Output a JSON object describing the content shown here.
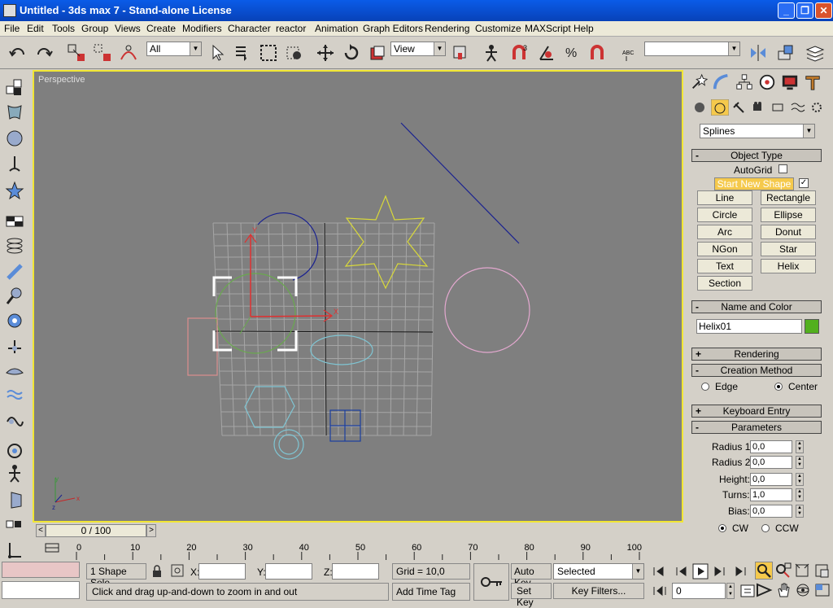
{
  "window": {
    "title": "Untitled - 3ds max 7  - Stand-alone License"
  },
  "menu": [
    "File",
    "Edit",
    "Tools",
    "Group",
    "Views",
    "Create",
    "Modifiers",
    "Character",
    "reactor",
    "Animation",
    "Graph Editors",
    "Rendering",
    "Customize",
    "MAXScript",
    "Help"
  ],
  "toolbar": {
    "selection_filter": "All",
    "ref_coord": "View",
    "named_selection": ""
  },
  "viewport": {
    "label": "Perspective"
  },
  "command_panel": {
    "category_dropdown": "Splines",
    "object_type": {
      "header": "Object Type",
      "autogrid": "AutoGrid",
      "start_new_shape": "Start New Shape",
      "buttons": [
        "Line",
        "Rectangle",
        "Circle",
        "Ellipse",
        "Arc",
        "Donut",
        "NGon",
        "Star",
        "Text",
        "Helix",
        "Section"
      ]
    },
    "name_color": {
      "header": "Name and Color",
      "name": "Helix01",
      "color": "#52b01e"
    },
    "rendering": {
      "header": "Rendering"
    },
    "creation_method": {
      "header": "Creation Method",
      "edge": "Edge",
      "center": "Center"
    },
    "keyboard_entry": {
      "header": "Keyboard Entry"
    },
    "parameters": {
      "header": "Parameters",
      "radius1_label": "Radius 1:",
      "radius1": "0,0",
      "radius2_label": "Radius 2:",
      "radius2": "0,0",
      "height_label": "Height:",
      "height": "0,0",
      "turns_label": "Turns:",
      "turns": "1,0",
      "bias_label": "Bias:",
      "bias": "0,0",
      "cw": "CW",
      "ccw": "CCW"
    }
  },
  "timeline": {
    "slider_label": "0 / 100",
    "ticks": [
      "0",
      "10",
      "20",
      "30",
      "40",
      "50",
      "60",
      "70",
      "80",
      "90",
      "100"
    ]
  },
  "status": {
    "selection": "1 Shape Sele",
    "x_label": "X:",
    "y_label": "Y:",
    "z_label": "Z:",
    "grid": "Grid = 10,0",
    "auto_key": "Auto Key",
    "set_key": "Set Key",
    "key_mode": "Selected",
    "key_filters": "Key Filters...",
    "add_time_tag": "Add Time Tag",
    "prompt": "Click and drag up-and-down to zoom in and out",
    "frame": "0"
  },
  "colors": {
    "viewport_bg": "#7f7f7f",
    "viewport_border": "#f1e633",
    "panel_bg": "#d4d0c8",
    "active_button": "#f5c94c"
  }
}
